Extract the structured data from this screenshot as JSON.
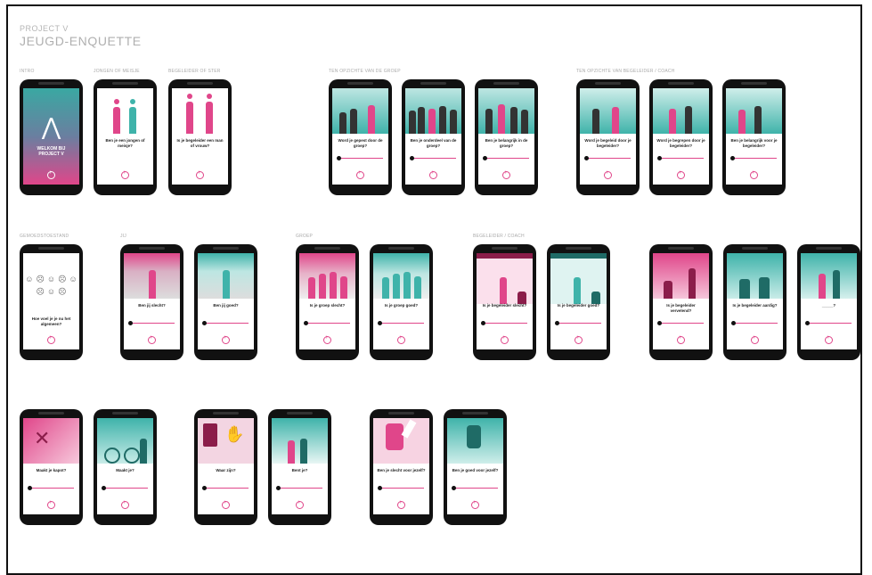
{
  "header": {
    "subtitle": "PROJECT V",
    "title": "JEUGD-ENQUETTE"
  },
  "sections": [
    {
      "id": "intro",
      "label": "INTRO"
    },
    {
      "id": "jongen",
      "label": "JONGEN OF MEISJE"
    },
    {
      "id": "begeleider",
      "label": "BEGELEIDER OF STER"
    },
    {
      "id": "groep-t",
      "label": "TEN OPZICHTE VAN DE GROEP"
    },
    {
      "id": "coach-t",
      "label": "TEN OPZICHTE VAN BEGELEIDER / COACH"
    },
    {
      "id": "gemoed",
      "label": "GEMOEDSTOESTAND"
    },
    {
      "id": "jij",
      "label": "JIJ"
    },
    {
      "id": "groep",
      "label": "GROEP"
    },
    {
      "id": "coach",
      "label": "BEGELEIDER / COACH"
    }
  ],
  "intro": {
    "brand_line1": "WELKOM BIJ",
    "brand_line2": "PROJECT V",
    "logo_icon": "bird-logo-icon"
  },
  "phones": [
    {
      "q": "Ben je een jongen of meisje?"
    },
    {
      "q": "Is je begeleider een man of vrouw?"
    },
    {
      "q": "Word je gepest door de groep?"
    },
    {
      "q": "Ben je onderdeel van de groep?"
    },
    {
      "q": "Ben je belangrijk in de groep?"
    },
    {
      "q": "Word je begeleid door je begeleider?"
    },
    {
      "q": "Word je begrepen door je begeleider?"
    },
    {
      "q": "Ben je belangrijk voor je begeleider?"
    },
    {
      "q": "Hoe voel je je nu het algemeen?"
    },
    {
      "q": "Ben jij slecht?"
    },
    {
      "q": "Ben jij goed?"
    },
    {
      "q": "Is je groep slecht?"
    },
    {
      "q": "Is je groep goed?"
    },
    {
      "q": "Is je begeleider slecht?"
    },
    {
      "q": "Is je begeleider goed?"
    },
    {
      "q": "Is je begeleider vervelend?"
    },
    {
      "q": "Is je begeleider aardig?"
    },
    {
      "q": "_____?"
    },
    {
      "q": "Maakt je kapot?"
    },
    {
      "q": "Maakt je?"
    },
    {
      "q": "Waar zijn?"
    },
    {
      "q": "Bent je?"
    },
    {
      "q": "Ben je slecht voor jezelf?"
    },
    {
      "q": "Ben je goed voor jezelf?"
    }
  ],
  "colors": {
    "pink": "#e0468a",
    "teal": "#3fb3aa",
    "dark": "#111111"
  }
}
